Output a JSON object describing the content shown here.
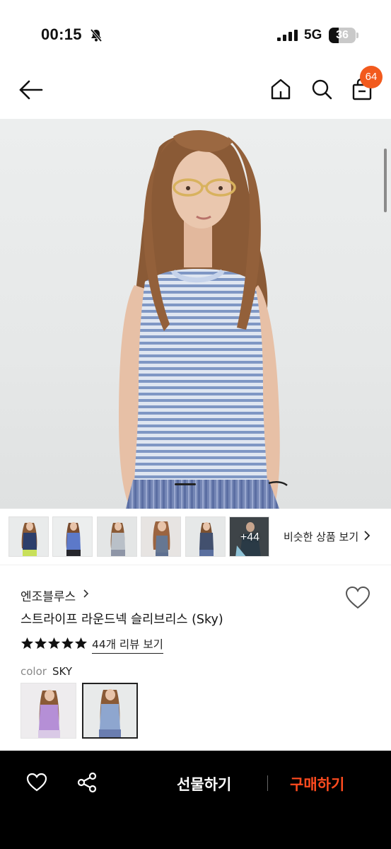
{
  "status_bar": {
    "time": "00:15",
    "network": "5G",
    "battery_level": "36",
    "battery_fraction": 0.36
  },
  "nav": {
    "icons": [
      "back-arrow-icon",
      "home-icon",
      "search-icon",
      "shopping-bag-icon"
    ],
    "cart_count": "64"
  },
  "gallery": {
    "more_count": "+44",
    "similar_label": "비슷한 상품 보기"
  },
  "product": {
    "brand": "엔조블루스",
    "name": "스트라이프 라운드넥 슬리브리스 (Sky)",
    "rating_stars": 5,
    "review_link": "44개 리뷰 보기",
    "color_label": "color",
    "color_value": "SKY"
  },
  "bottom_bar": {
    "gift_label": "선물하기",
    "buy_label": "구매하기"
  },
  "colors": {
    "accent": "#f25a1d",
    "buy": "#ff4b1f",
    "stripe_blue": "#7f97c4"
  }
}
